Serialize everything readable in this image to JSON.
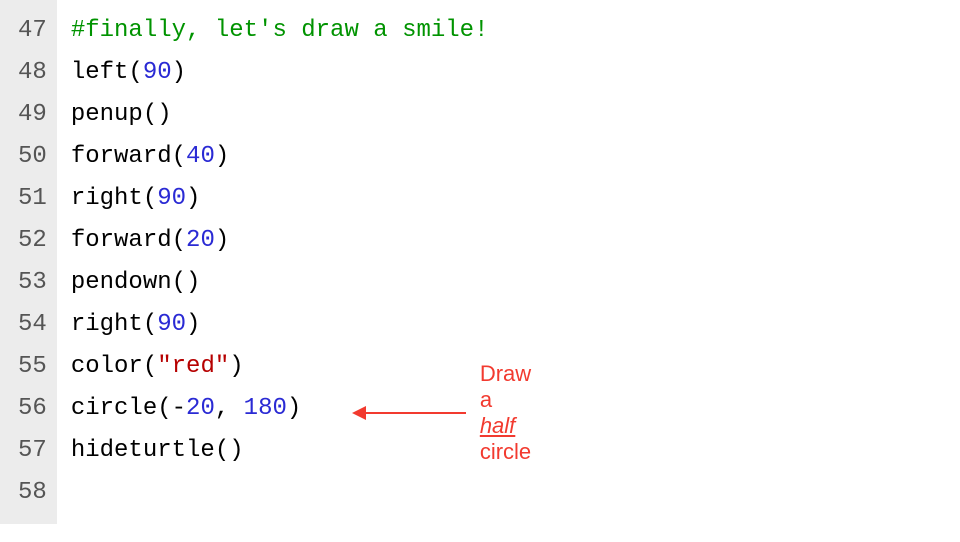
{
  "colors": {
    "comment": "#009300",
    "number": "#2a2ad4",
    "string": "#b60000",
    "annotation": "#f23a2f",
    "gutter_bg": "#ececec"
  },
  "gutter": {
    "lines": [
      "47",
      "48",
      "49",
      "50",
      "51",
      "52",
      "53",
      "54",
      "55",
      "56",
      "57",
      "58"
    ]
  },
  "code": [
    {
      "n": "47",
      "tokens": [
        {
          "cls": "tok-comment",
          "t": "#finally, let's draw a smile!"
        }
      ]
    },
    {
      "n": "48",
      "tokens": [
        {
          "cls": "tok-ident",
          "t": "left"
        },
        {
          "cls": "tok-paren",
          "t": "("
        },
        {
          "cls": "tok-number",
          "t": "90"
        },
        {
          "cls": "tok-paren",
          "t": ")"
        }
      ]
    },
    {
      "n": "49",
      "tokens": [
        {
          "cls": "tok-ident",
          "t": "penup"
        },
        {
          "cls": "tok-paren",
          "t": "("
        },
        {
          "cls": "tok-paren",
          "t": ")"
        }
      ]
    },
    {
      "n": "50",
      "tokens": [
        {
          "cls": "tok-ident",
          "t": "forward"
        },
        {
          "cls": "tok-paren",
          "t": "("
        },
        {
          "cls": "tok-number",
          "t": "40"
        },
        {
          "cls": "tok-paren",
          "t": ")"
        }
      ]
    },
    {
      "n": "51",
      "tokens": [
        {
          "cls": "tok-ident",
          "t": "right"
        },
        {
          "cls": "tok-paren",
          "t": "("
        },
        {
          "cls": "tok-number",
          "t": "90"
        },
        {
          "cls": "tok-paren",
          "t": ")"
        }
      ]
    },
    {
      "n": "52",
      "tokens": [
        {
          "cls": "tok-ident",
          "t": "forward"
        },
        {
          "cls": "tok-paren",
          "t": "("
        },
        {
          "cls": "tok-number",
          "t": "20"
        },
        {
          "cls": "tok-paren",
          "t": ")"
        }
      ]
    },
    {
      "n": "53",
      "tokens": [
        {
          "cls": "tok-ident",
          "t": "pendown"
        },
        {
          "cls": "tok-paren",
          "t": "("
        },
        {
          "cls": "tok-paren",
          "t": ")"
        }
      ]
    },
    {
      "n": "54",
      "tokens": [
        {
          "cls": "tok-ident",
          "t": "right"
        },
        {
          "cls": "tok-paren",
          "t": "("
        },
        {
          "cls": "tok-number",
          "t": "90"
        },
        {
          "cls": "tok-paren",
          "t": ")"
        }
      ]
    },
    {
      "n": "55",
      "tokens": [
        {
          "cls": "tok-ident",
          "t": "color"
        },
        {
          "cls": "tok-paren",
          "t": "("
        },
        {
          "cls": "tok-string",
          "t": "\"red\""
        },
        {
          "cls": "tok-paren",
          "t": ")"
        }
      ]
    },
    {
      "n": "56",
      "tokens": [
        {
          "cls": "tok-ident",
          "t": "circle"
        },
        {
          "cls": "tok-paren",
          "t": "("
        },
        {
          "cls": "tok-op",
          "t": "-"
        },
        {
          "cls": "tok-number",
          "t": "20"
        },
        {
          "cls": "tok-op",
          "t": ", "
        },
        {
          "cls": "tok-number",
          "t": "180"
        },
        {
          "cls": "tok-paren",
          "t": ")"
        }
      ]
    },
    {
      "n": "57",
      "tokens": [
        {
          "cls": "tok-ident",
          "t": "hideturtle"
        },
        {
          "cls": "tok-paren",
          "t": "("
        },
        {
          "cls": "tok-paren",
          "t": ")"
        }
      ]
    },
    {
      "n": "58",
      "tokens": []
    }
  ],
  "annotation": {
    "prefix": "Draw a ",
    "emph": "half",
    "suffix": " circle"
  }
}
